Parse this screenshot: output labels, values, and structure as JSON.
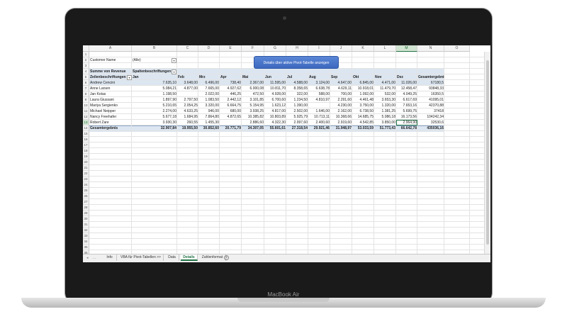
{
  "device": {
    "brand_label": "MacBook Air"
  },
  "columns": [
    "A",
    "B",
    "C",
    "D",
    "E",
    "F",
    "G",
    "H",
    "I",
    "J",
    "K",
    "L",
    "M",
    "N",
    "O"
  ],
  "rows": [
    "1",
    "2",
    "3",
    "4",
    "5",
    "6",
    "7",
    "8",
    "9",
    "10",
    "11",
    "12",
    "13",
    "14",
    "15",
    "16",
    "17",
    "18",
    "19",
    "20",
    "21",
    "22",
    "23",
    "24",
    "25",
    "26",
    "27",
    "28",
    "29",
    "30",
    "31",
    "32",
    "33",
    "34",
    "35",
    "36"
  ],
  "filter": {
    "label": "Customer Name",
    "value": "(Alle)"
  },
  "button": {
    "label": "Details über aktive Pivot-Tabelle anzeigen"
  },
  "pivot": {
    "values_label": "Summe von Revenue",
    "columns_label": "Spaltenbeschriftungen",
    "rows_label": "Zeilenbeschriftungen",
    "months": [
      "Jan",
      "Feb",
      "Mrz",
      "Apr",
      "Mai",
      "Jun",
      "Jul",
      "Aug",
      "Sep",
      "Okt",
      "Nov",
      "Dez"
    ],
    "grand_total_label": "Gesamtergebnis",
    "data_rows": [
      {
        "name": "Andrew Cencini",
        "values": [
          "7.635,10",
          "3.648,00",
          "6.496,00",
          "738,40",
          "2.367,00",
          "11.595,00",
          "4.588,00",
          "3.124,00",
          "4.647,00",
          "6.845,00",
          "4.471,00",
          "11.026,00"
        ],
        "total": "67180,5"
      },
      {
        "name": "Anne Larsen",
        "values": [
          "5.084,21",
          "4.877,00",
          "7.665,00",
          "4.927,62",
          "6.000,08",
          "10.811,70",
          "8.358,65",
          "6.638,78",
          "4.629,11",
          "10.918,01",
          "11.479,70",
          "12.458,47"
        ],
        "total": "93848,33"
      },
      {
        "name": "Jan Kotas",
        "values": [
          "1.198,50",
          "",
          "2.022,00",
          "446,25",
          "472,50",
          "4.928,00",
          "322,00",
          "588,00",
          "700,00",
          "1.092,00",
          "532,00",
          "4.049,25"
        ],
        "total": "16350,5"
      },
      {
        "name": "Laura Giussani",
        "values": [
          "1.897,90",
          "2.797,50",
          "1.083,50",
          "2.442,12",
          "3.101,85",
          "6.700,60",
          "1.234,50",
          "4.810,97",
          "2.291,60",
          "4.461,48",
          "3.653,30",
          "6.617,69"
        ],
        "total": "41095,01"
      },
      {
        "name": "Mariya Sergienko",
        "values": [
          "5.210,65",
          "2.054,25",
          "3.320,00",
          "6.664,75",
          "5.154,95",
          "1.623,12",
          "1.390,00",
          "",
          "4.230,00",
          "3.750,00",
          "1.320,00",
          "7.653,16"
        ],
        "total": "42370,88"
      },
      {
        "name": "Michael Neipper",
        "values": [
          "2.274,00",
          "4.633,25",
          "946,00",
          "680,00",
          "3.938,25",
          "4.817,00",
          "2.502,00",
          "1.646,00",
          "2.162,00",
          "6.738,50",
          "1.381,25",
          "5.699,75"
        ],
        "total": "37418"
      },
      {
        "name": "Nancy Freehafer",
        "values": [
          "5.677,18",
          "1.684,95",
          "7.864,80",
          "4.872,65",
          "10.385,82",
          "10.803,89",
          "5.925,79",
          "10.713,11",
          "10.368,66",
          "14.685,75",
          "5.086,18",
          "16.173,56"
        ],
        "total": "104242,34"
      },
      {
        "name": "Robert Zare",
        "values": [
          "3.930,30",
          "260,55",
          "1.455,30",
          "",
          "2.886,60",
          "4.322,30",
          "2.997,60",
          "2.400,60",
          "2.919,60",
          "4.542,85",
          "3.850,00",
          "2.964,90"
        ],
        "total": "32530,6"
      }
    ],
    "totals": {
      "values": [
        "32.907,84",
        "19.955,50",
        "30.852,60",
        "20.771,79",
        "34.307,05",
        "55.601,61",
        "27.318,54",
        "29.921,46",
        "31.948,97",
        "53.033,59",
        "51.773,43",
        "66.642,78"
      ],
      "grand": "435036,16"
    }
  },
  "sheet_tabs": {
    "nav_prev": "◂",
    "nav_more": "...",
    "items": [
      "Info",
      "VBA für Pivot-Tabellen >>",
      "Data",
      "Details",
      "Zahlenformat"
    ],
    "active": "Details",
    "add_symbol": "+"
  },
  "colors": {
    "accent": "#217346",
    "pivot_header": "#dce6f1",
    "button": "#4472c4"
  }
}
